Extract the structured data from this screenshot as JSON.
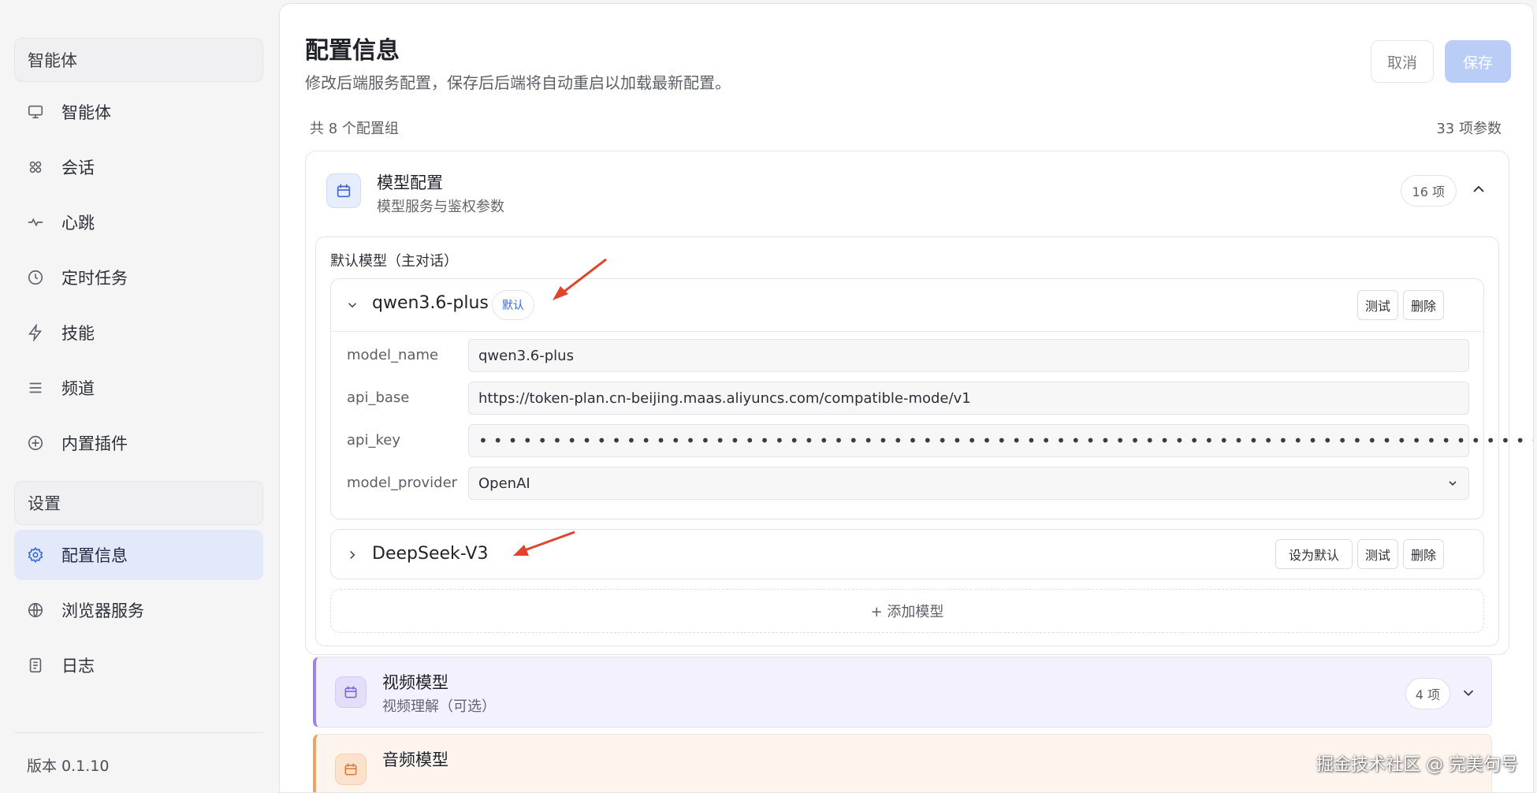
{
  "sidebar": {
    "section_agent": "智能体",
    "items_top": [
      {
        "label": "智能体",
        "icon": "monitor-icon"
      },
      {
        "label": "会话",
        "icon": "chat-icon"
      },
      {
        "label": "心跳",
        "icon": "heartbeat-icon"
      },
      {
        "label": "定时任务",
        "icon": "clock-icon"
      },
      {
        "label": "技能",
        "icon": "bolt-icon"
      },
      {
        "label": "频道",
        "icon": "menu-icon"
      },
      {
        "label": "内置插件",
        "icon": "plus-circle-icon"
      }
    ],
    "section_settings": "设置",
    "items_bottom": [
      {
        "label": "配置信息",
        "icon": "gear-icon",
        "active": true
      },
      {
        "label": "浏览器服务",
        "icon": "globe-icon"
      },
      {
        "label": "日志",
        "icon": "document-icon"
      }
    ],
    "version": "版本 0.1.10"
  },
  "header": {
    "title": "配置信息",
    "subtitle": "修改后端服务配置，保存后后端将自动重启以加载最新配置。",
    "cancel_label": "取消",
    "save_label": "保存"
  },
  "summary": {
    "groups": "共 8 个配置组",
    "params": "33 项参数"
  },
  "model_group": {
    "title": "模型配置",
    "subtitle": "模型服务与鉴权参数",
    "count": "16 项",
    "section_title": "默认模型（主对话）",
    "models": [
      {
        "name": "qwen3.6-plus",
        "default_tag": "默认",
        "test_label": "测试",
        "delete_label": "删除",
        "fields": [
          {
            "label": "model_name",
            "value": "qwen3.6-plus"
          },
          {
            "label": "api_base",
            "value": "https://token-plan.cn-beijing.maas.aliyuncs.com/compatible-mode/v1"
          },
          {
            "label": "api_key",
            "value": "••••••••••••••••••••••••••••••••••••••••••••••••••••••••••••••••••••••••"
          },
          {
            "label": "model_provider",
            "value": "OpenAI"
          }
        ]
      },
      {
        "name": "DeepSeek-V3",
        "set_default_label": "设为默认",
        "test_label": "测试",
        "delete_label": "删除"
      }
    ],
    "add_label": "+ 添加模型"
  },
  "video_group": {
    "title": "视频模型",
    "subtitle": "视频理解（可选）",
    "count": "4 项"
  },
  "audio_group": {
    "title": "音频模型"
  },
  "watermark": "掘金技术社区 @ 完美句号",
  "colors": {
    "accent": "#3a66d6",
    "save_disabled": "#b9cdf7",
    "active_nav_bg": "#e3e9f9",
    "video_accent": "#9a84e6",
    "audio_accent": "#eaa46a",
    "annotation_arrow": "#e0452b"
  }
}
